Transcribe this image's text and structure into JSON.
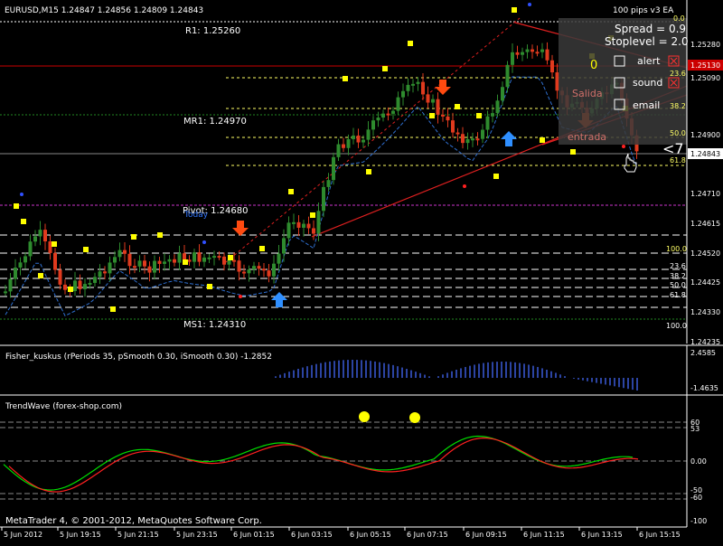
{
  "header": {
    "symbol_line": "EURUSD,M15  1.24847 1.24856 1.24809 1.24843",
    "ea_title": "100 pips v3 EA"
  },
  "ea_panel": {
    "spread": "Spread = 0.9",
    "stoplevel": "Stoplevel = 2.0",
    "zero": "0",
    "alert": "alert",
    "sound": "sound",
    "email": "email",
    "salida": "Salida",
    "entrada": "entrada",
    "lt7": "<7"
  },
  "pivots": {
    "r1": "R1: 1.25260",
    "mr1": "MR1: 1.24970",
    "pivot": "Pivot: 1.24680",
    "today": "Today",
    "ms1": "MS1: 1.24310"
  },
  "fib_labels": {
    "f00": "0.0",
    "f236": "23.6",
    "f382": "38.2",
    "f500": "50.0",
    "f618": "61.8",
    "g1000": "100.0",
    "g236": "23.6",
    "g382": "38.2",
    "g500": "50.0",
    "g618": "61.8",
    "ms100": "100.0"
  },
  "price_axis": {
    "ticks": [
      "1.25280",
      "1.25090",
      "1.24900",
      "1.24710",
      "1.24615",
      "1.24520",
      "1.24425",
      "1.24330",
      "1.24235"
    ],
    "current_price": "1.24843",
    "red_price": "1.25130"
  },
  "fisher": {
    "label": "Fisher_kuskus  (rPeriods 35, pSmooth 0.30, iSmooth 0.30)   -1.2852",
    "ticks": [
      "2.4585",
      "-1.4635"
    ]
  },
  "trendwave": {
    "label": "TrendWave (forex-shop.com)",
    "ticks": [
      "60",
      "53",
      "0.00",
      "-50",
      "-60",
      "-100"
    ]
  },
  "time_axis": {
    "labels": [
      "5 Jun 2012",
      "5 Jun 19:15",
      "5 Jun 21:15",
      "5 Jun 23:15",
      "6 Jun 01:15",
      "6 Jun 03:15",
      "6 Jun 05:15",
      "6 Jun 07:15",
      "6 Jun 09:15",
      "6 Jun 11:15",
      "6 Jun 13:15",
      "6 Jun 15:15"
    ]
  },
  "footer": {
    "copyright": "MetaTrader 4, © 2001-2012, MetaQuotes Software Corp."
  },
  "colors": {
    "bull": "#2e8b2e",
    "bear": "#e03a1e",
    "pivot_line": "#cc33cc",
    "res_line": "#cc0000",
    "signal_yellow": "#ffff00",
    "arrow_up": "#2f8fff",
    "arrow_down": "#ff4a10",
    "ma_blue": "#2f6fd0",
    "fisher_bar": "#3a5bd8",
    "tw_green": "#00dd00",
    "tw_red": "#ff2020"
  }
}
